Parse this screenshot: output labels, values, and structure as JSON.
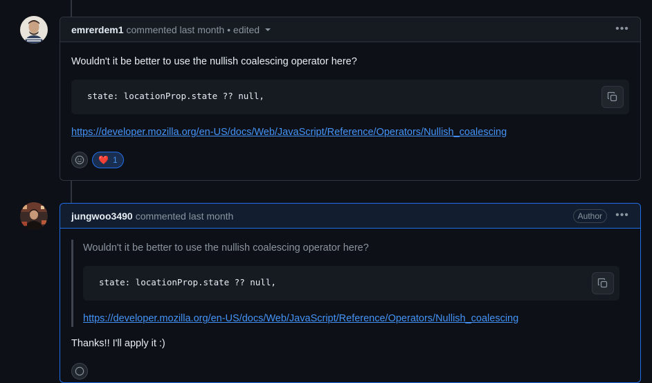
{
  "comments": [
    {
      "username": "emrerdem1",
      "meta": "commented last month",
      "edited": "• edited",
      "body": "Wouldn't it be better to use the nullish coalescing operator here?",
      "code": "state: locationProp.state ?? null,",
      "link": "https://developer.mozilla.org/en-US/docs/Web/JavaScript/Reference/Operators/Nullish_coalescing",
      "reaction": {
        "emoji": "❤️",
        "count": "1"
      }
    },
    {
      "username": "jungwoo3490",
      "meta": "commented last month",
      "badge": "Author",
      "quote_body": "Wouldn't it be better to use the nullish coalescing operator here?",
      "quote_code": "state: locationProp.state ?? null,",
      "quote_link": "https://developer.mozilla.org/en-US/docs/Web/JavaScript/Reference/Operators/Nullish_coalescing",
      "body": "Thanks!! I'll apply it :)"
    }
  ],
  "icons": {
    "more": "kebab-horizontal-icon",
    "copy": "copy-icon",
    "smiley": "smiley-icon",
    "caret": "triangle-down-icon"
  },
  "colors": {
    "link": "#4493f8",
    "author_border": "#1f6feb",
    "heart": "#f85149"
  }
}
